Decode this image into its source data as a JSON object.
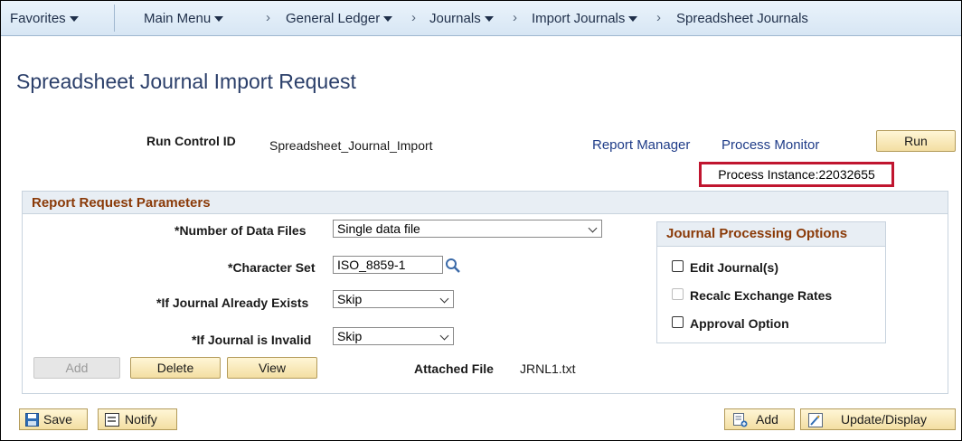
{
  "nav": {
    "favorites": "Favorites",
    "main_menu": "Main Menu",
    "breadcrumbs": [
      "General Ledger",
      "Journals",
      "Import Journals",
      "Spreadsheet Journals"
    ]
  },
  "page_title": "Spreadsheet Journal Import Request",
  "run_control": {
    "label": "Run Control ID",
    "value": "Spreadsheet_Journal_Import",
    "report_manager": "Report Manager",
    "process_monitor": "Process Monitor",
    "run_button": "Run",
    "process_instance": "Process Instance:22032655"
  },
  "params": {
    "header": "Report Request Parameters",
    "num_files_label": "*Number of Data Files",
    "num_files_value": "Single data file",
    "charset_label": "*Character Set",
    "charset_value": "ISO_8859-1",
    "exists_label": "*If Journal Already Exists",
    "exists_value": "Skip",
    "invalid_label": "*If Journal is Invalid",
    "invalid_value": "Skip",
    "add_button": "Add",
    "delete_button": "Delete",
    "view_button": "View",
    "attached_label": "Attached File",
    "attached_value": "JRNL1.txt"
  },
  "jpo": {
    "header": "Journal Processing Options",
    "edit_journal": "Edit Journal(s)",
    "recalc": "Recalc Exchange Rates",
    "approval": "Approval Option"
  },
  "footer": {
    "save": "Save",
    "notify": "Notify",
    "add": "Add",
    "update_display": "Update/Display"
  },
  "colors": {
    "highlight_border": "#c0152f",
    "section_header_text": "#8a3a08",
    "title_text": "#2b3f6a"
  }
}
